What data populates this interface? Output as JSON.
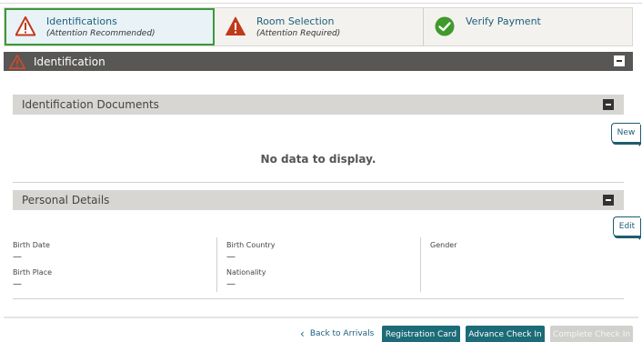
{
  "steps": [
    {
      "title": "Identifications",
      "subtitle": "(Attention Recommended)",
      "status": "warning",
      "active": true
    },
    {
      "title": "Room Selection",
      "subtitle": "(Attention Required)",
      "status": "warning",
      "active": false
    },
    {
      "title": "Verify Payment",
      "subtitle": "",
      "status": "complete",
      "active": false
    }
  ],
  "identification": {
    "title": "Identification",
    "documents": {
      "title": "Identification Documents",
      "new_label": "New",
      "empty_message": "No data to display."
    },
    "personal": {
      "title": "Personal Details",
      "edit_label": "Edit",
      "fields": {
        "birth_date": {
          "label": "Birth Date",
          "value": "—"
        },
        "birth_place": {
          "label": "Birth Place",
          "value": "—"
        },
        "birth_country": {
          "label": "Birth Country",
          "value": "—"
        },
        "nationality": {
          "label": "Nationality",
          "value": "—"
        },
        "gender": {
          "label": "Gender",
          "value": ""
        }
      }
    }
  },
  "footer": {
    "back_label": "Back to Arrivals",
    "registration_card": "Registration Card",
    "advance_check_in": "Advance Check In",
    "complete_check_in": "Complete Check In"
  },
  "colors": {
    "accent": "#1c6b78",
    "warning": "#c0391b",
    "success": "#3f9a2b",
    "active_outline": "#3a9a3a"
  },
  "icons": {
    "warning": "warning-triangle-icon",
    "complete": "check-circle-icon",
    "collapse": "collapse-minus-icon",
    "back": "chevron-left-icon"
  }
}
